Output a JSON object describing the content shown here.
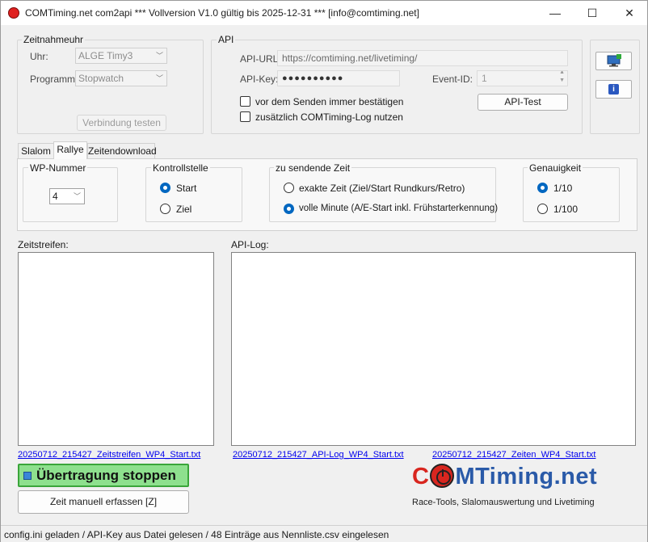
{
  "window": {
    "title": "COMTiming.net com2api *** Vollversion V1.0 gültig bis 2025-12-31 *** [info@comtiming.net]",
    "minimize_glyph": "—",
    "maximize_glyph": "☐",
    "close_glyph": "✕"
  },
  "zeitnahmeuhr": {
    "group_label": "Zeitnahmeuhr",
    "uhr_label": "Uhr:",
    "uhr_value": "ALGE Timy3",
    "programm_label": "Programm:",
    "programm_value": "Stopwatch",
    "test_button": "Verbindung testen"
  },
  "api": {
    "group_label": "API",
    "url_label": "API-URL:",
    "url_value": "https://comtiming.net/livetiming/",
    "key_label": "API-Key:",
    "key_value": "●●●●●●●●●●",
    "event_label": "Event-ID:",
    "event_value": "1",
    "confirm_label": "vor dem Senden immer bestätigen",
    "log_label": "zusätzlich COMTiming-Log nutzen",
    "test_button": "API-Test"
  },
  "side": {
    "screen_icon": "monitor-add-icon",
    "info_icon": "info-icon",
    "info_glyph": "i"
  },
  "tabs": [
    {
      "label": "Slalom",
      "active": false
    },
    {
      "label": "Rallye",
      "active": true
    },
    {
      "label": "Zeitendownload",
      "active": false
    }
  ],
  "rallye": {
    "wp_group": "WP-Nummer",
    "wp_value": "4",
    "kontroll_group": "Kontrollstelle",
    "kontroll_options": [
      {
        "label": "Start",
        "checked": true
      },
      {
        "label": "Ziel",
        "checked": false
      }
    ],
    "zeit_group": "zu sendende Zeit",
    "zeit_options": [
      {
        "label": "exakte Zeit (Ziel/Start Rundkurs/Retro)",
        "checked": false
      },
      {
        "label": "volle Minute (A/E-Start inkl. Frühstarterkennung)",
        "checked": true
      }
    ],
    "genau_group": "Genauigkeit",
    "genau_options": [
      {
        "label": "1/10",
        "checked": true
      },
      {
        "label": "1/100",
        "checked": false
      }
    ]
  },
  "logs": {
    "zeitstreifen_label": "Zeitstreifen:",
    "apilog_label": "API-Log:",
    "link_zeitstreifen": "20250712_215427_Zeitstreifen_WP4_Start.txt",
    "link_apilog": "20250712_215427_API-Log_WP4_Start.txt",
    "link_zeiten": "20250712_215427_Zeiten_WP4_Start.txt"
  },
  "actions": {
    "stop_button": "Übertragung stoppen",
    "manual_button": "Zeit manuell erfassen [Z]"
  },
  "logo": {
    "part1": "C",
    "part2": "MTiming.net",
    "subtitle": "Race-Tools, Slalomauswertung und Livetiming",
    "red": "#d8261f",
    "blue": "#2a5aa8"
  },
  "status": {
    "text": "config.ini geladen / API-Key aus Datei gelesen / 48 Einträge aus Nennliste.csv eingelesen"
  },
  "colors": {
    "accent": "#0067c0",
    "stop_green": "#8ee08e"
  }
}
